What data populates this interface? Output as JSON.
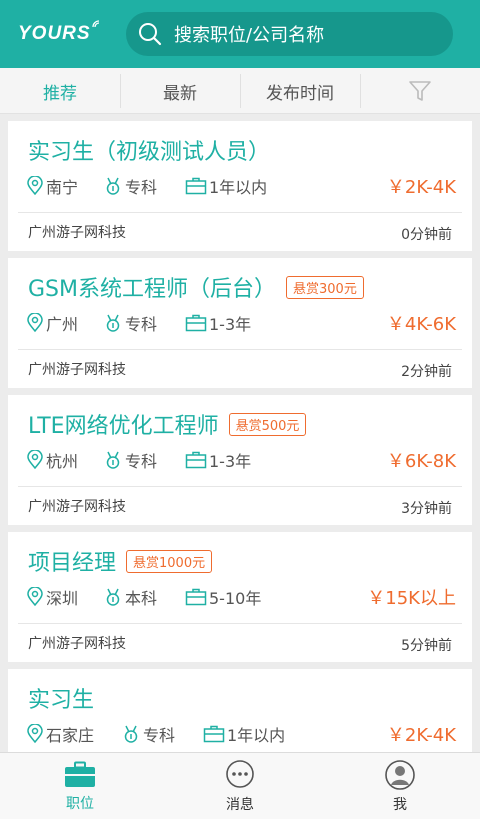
{
  "header": {
    "logo": "YOURS",
    "search_placeholder": "搜索职位/公司名称",
    "accent": "#1fb0a4"
  },
  "tabs": [
    {
      "label": "推荐",
      "active": true
    },
    {
      "label": "最新",
      "active": false
    },
    {
      "label": "发布时间",
      "active": false
    },
    {
      "icon": "filter-icon"
    }
  ],
  "jobs": [
    {
      "title": "实习生（初级测试人员）",
      "reward": "",
      "city": "南宁",
      "education": "专科",
      "experience": "1年以内",
      "salary": "￥2K-4K",
      "company": "广州游子网科技",
      "time": "0分钟前"
    },
    {
      "title": "GSM系统工程师（后台）",
      "reward": "悬赏300元",
      "city": "广州",
      "education": "专科",
      "experience": "1-3年",
      "salary": "￥4K-6K",
      "company": "广州游子网科技",
      "time": "2分钟前"
    },
    {
      "title": "LTE网络优化工程师",
      "reward": "悬赏500元",
      "city": "杭州",
      "education": "专科",
      "experience": "1-3年",
      "salary": "￥6K-8K",
      "company": "广州游子网科技",
      "time": "3分钟前"
    },
    {
      "title": "项目经理",
      "reward": "悬赏1000元",
      "city": "深圳",
      "education": "本科",
      "experience": "5-10年",
      "salary": "￥15K以上",
      "company": "广州游子网科技",
      "time": "5分钟前"
    },
    {
      "title": "实习生",
      "reward": "",
      "city": "石家庄",
      "education": "专科",
      "experience": "1年以内",
      "salary": "￥2K-4K",
      "company": "",
      "time": ""
    }
  ],
  "bottom_nav": [
    {
      "label": "职位",
      "icon": "briefcase-icon",
      "active": true
    },
    {
      "label": "消息",
      "icon": "chat-icon",
      "active": false
    },
    {
      "label": "我",
      "icon": "user-icon",
      "active": false
    }
  ]
}
